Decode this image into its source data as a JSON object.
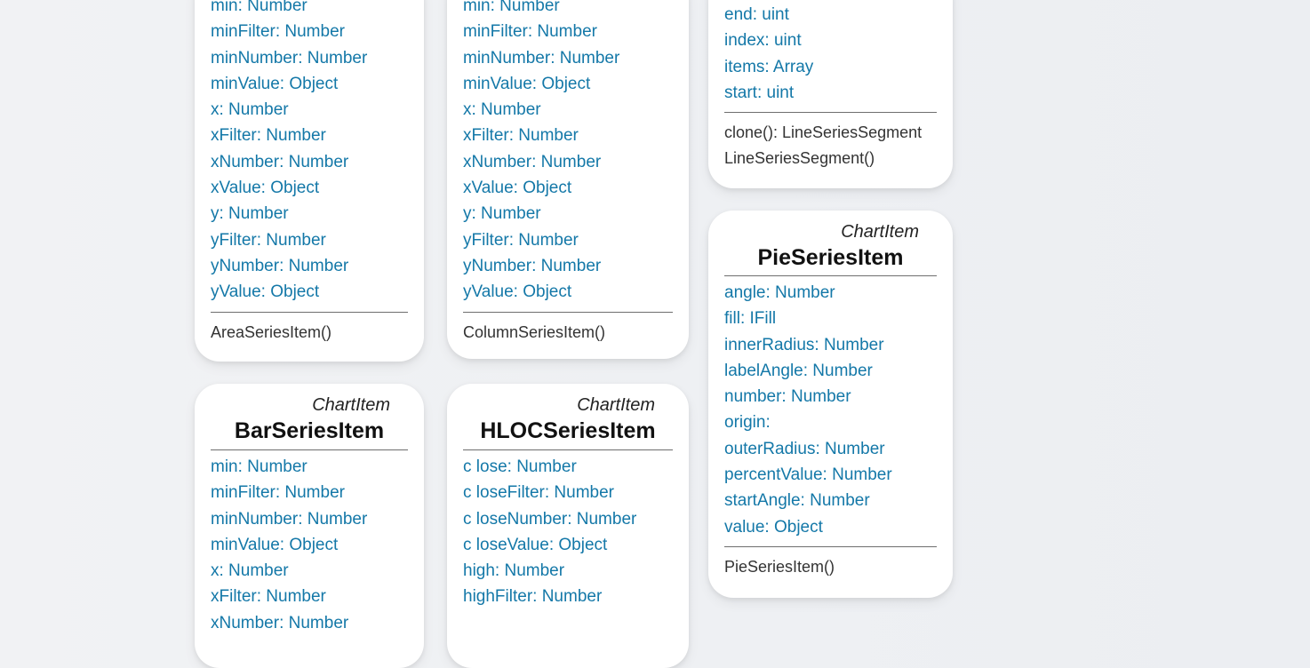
{
  "cards": {
    "area": {
      "props": [
        "min: Number",
        "minFilter: Number",
        "minNumber: Number",
        "minValue: Object",
        "x: Number",
        "xFilter: Number",
        "xNumber: Number",
        "xValue: Object",
        "y: Number",
        "yFilter: Number",
        "yNumber: Number",
        "yValue: Object"
      ],
      "methods": [
        "AreaSeriesItem()"
      ]
    },
    "column": {
      "props": [
        "min: Number",
        "minFilter: Number",
        "minNumber: Number",
        "minValue: Object",
        "x: Number",
        "xFilter: Number",
        "xNumber: Number",
        "xValue: Object",
        "y: Number",
        "yFilter: Number",
        "yNumber: Number",
        "yValue: Object"
      ],
      "methods": [
        "ColumnSeriesItem()"
      ]
    },
    "lineSegment": {
      "props": [
        "end: uint",
        "index: uint",
        "items: Array",
        "start: uint"
      ],
      "methods": [
        "clone(): LineSeriesSegment",
        "LineSeriesSegment()"
      ]
    },
    "pie": {
      "stereotype": "ChartItem",
      "name": "PieSeriesItem",
      "props": [
        "angle: Number",
        "fill: IFill",
        "innerRadius: Number",
        "labelAngle: Number",
        "number: Number",
        "origin:",
        "outerRadius: Number",
        "percentValue: Number",
        "startAngle: Number",
        "value: Object"
      ],
      "methods": [
        "PieSeriesItem()"
      ]
    },
    "bar": {
      "stereotype": "ChartItem",
      "name": "BarSeriesItem",
      "props": [
        "min: Number",
        "minFilter: Number",
        "minNumber: Number",
        "minValue: Object",
        "x: Number",
        "xFilter: Number",
        "xNumber: Number"
      ]
    },
    "hloc": {
      "stereotype": "ChartItem",
      "name": "HLOCSeriesItem",
      "props": [
        "c lose: Number",
        "c loseFilter: Number",
        "c loseNumber: Number",
        "c loseValue: Object",
        "high: Number",
        "highFilter: Number"
      ]
    }
  },
  "colors": {
    "property": "#1478a8",
    "method": "#333333",
    "card": "#ffffff"
  }
}
